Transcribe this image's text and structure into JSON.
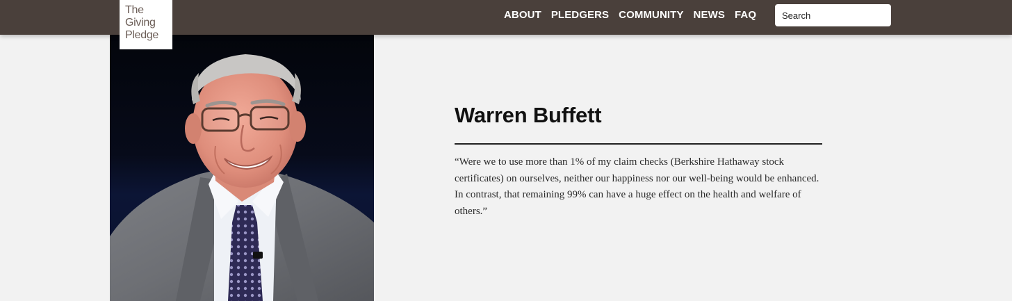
{
  "logo": {
    "line1": "The",
    "line2": "Giving",
    "line3": "Pledge"
  },
  "nav": {
    "items": [
      "ABOUT",
      "PLEDGERS",
      "COMMUNITY",
      "NEWS",
      "FAQ"
    ]
  },
  "search": {
    "placeholder": "Search"
  },
  "pledger": {
    "name": "Warren Buffett",
    "quote": "“Were we to use more than 1% of my claim checks (Berkshire Hathaway stock certificates) on ourselves, neither our happiness nor our well-being would be enhanced. In contrast, that remaining 99% can have a huge effect on the health and welfare of others.”"
  },
  "colors": {
    "header_bg": "#4a403b",
    "page_bg": "#f2f2f2",
    "logo_text": "#6b5d56"
  }
}
